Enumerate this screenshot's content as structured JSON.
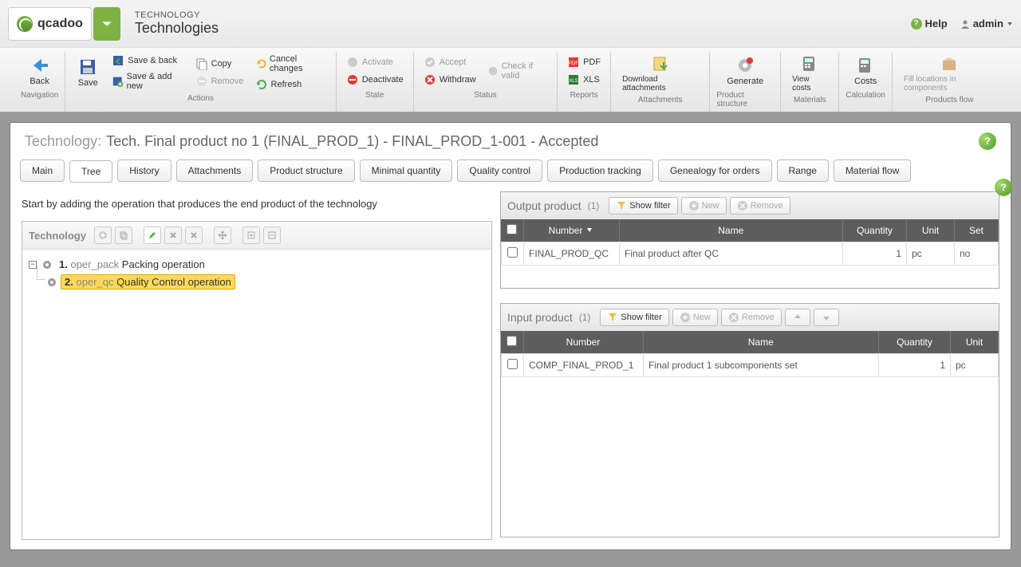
{
  "brand": "qcadoo",
  "breadcrumb": {
    "module": "TECHNOLOGY",
    "page": "Technologies"
  },
  "topright": {
    "help": "Help",
    "user": "admin"
  },
  "ribbon": {
    "navigation": {
      "label": "Navigation",
      "back": "Back"
    },
    "actions": {
      "label": "Actions",
      "save": "Save",
      "saveBack": "Save & back",
      "saveAddNew": "Save & add new",
      "copy": "Copy",
      "remove": "Remove",
      "cancel": "Cancel changes",
      "refresh": "Refresh"
    },
    "state": {
      "label": "State",
      "activate": "Activate",
      "deactivate": "Deactivate"
    },
    "status": {
      "label": "Status",
      "accept": "Accept",
      "withdraw": "Withdraw",
      "checkValid": "Check if valid"
    },
    "reports": {
      "label": "Reports",
      "pdf": "PDF",
      "xls": "XLS"
    },
    "attachments": {
      "label": "Attachments",
      "download": "Download attachments"
    },
    "productStructure": {
      "label": "Product structure",
      "generate": "Generate"
    },
    "materials": {
      "label": "Materials",
      "viewCosts": "View costs"
    },
    "calculation": {
      "label": "Calculation",
      "costs": "Costs"
    },
    "productsFlow": {
      "label": "Products flow",
      "fill": "Fill locations in components"
    }
  },
  "panel": {
    "prefix": "Technology:",
    "title": "Tech. Final product no 1 (FINAL_PROD_1) - FINAL_PROD_1-001 - Accepted"
  },
  "tabs": [
    "Main",
    "Tree",
    "History",
    "Attachments",
    "Product structure",
    "Minimal quantity",
    "Quality control",
    "Production tracking",
    "Genealogy for orders",
    "Range",
    "Material flow"
  ],
  "activeTab": "Tree",
  "hint": "Start by adding the operation that produces the end product of the technology",
  "tree": {
    "title": "Technology",
    "nodes": [
      {
        "num": "1.",
        "code": "oper_pack",
        "name": "Packing operation",
        "selected": false
      },
      {
        "num": "2.",
        "code": "oper_qc",
        "name": "Quality Control operation",
        "selected": true
      }
    ]
  },
  "outputGrid": {
    "title": "Output product",
    "count": "(1)",
    "showFilter": "Show filter",
    "new": "New",
    "remove": "Remove",
    "cols": [
      "",
      "Number",
      "Name",
      "Quantity",
      "Unit",
      "Set"
    ],
    "rows": [
      {
        "number": "FINAL_PROD_QC",
        "name": "Final product after QC",
        "qty": "1",
        "unit": "pc",
        "set": "no"
      }
    ]
  },
  "inputGrid": {
    "title": "Input product",
    "count": "(1)",
    "showFilter": "Show filter",
    "new": "New",
    "remove": "Remove",
    "cols": [
      "",
      "Number",
      "Name",
      "Quantity",
      "Unit"
    ],
    "rows": [
      {
        "number": "COMP_FINAL_PROD_1",
        "name": "Final product 1 subcomponents set",
        "qty": "1",
        "unit": "pc"
      }
    ]
  }
}
